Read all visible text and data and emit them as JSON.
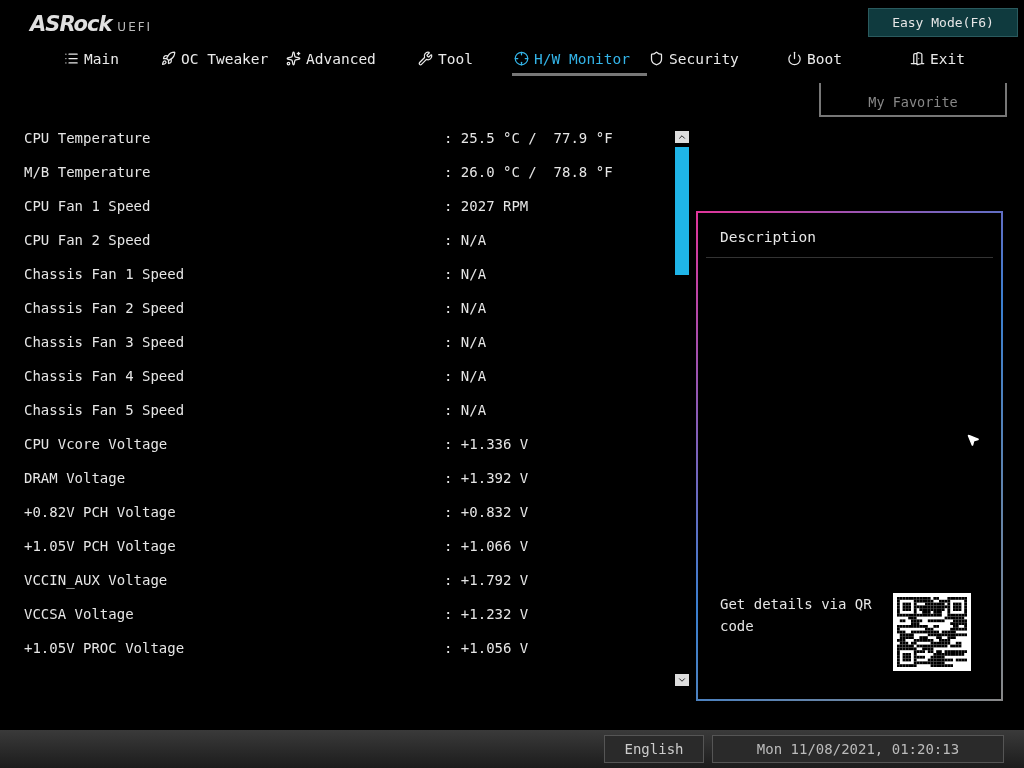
{
  "header": {
    "logo": "ASRock",
    "logo_suffix": "UEFI",
    "mode_button": "Easy Mode(F6)"
  },
  "tabs": [
    {
      "label": "Main",
      "kind": "list",
      "selected": false
    },
    {
      "label": "OC Tweaker",
      "kind": "rocket",
      "selected": false
    },
    {
      "label": "Advanced",
      "kind": "star",
      "selected": false
    },
    {
      "label": "Tool",
      "kind": "tools",
      "selected": false
    },
    {
      "label": "H/W Monitor",
      "kind": "monitor",
      "selected": true
    },
    {
      "label": "Security",
      "kind": "shield",
      "selected": false
    },
    {
      "label": "Boot",
      "kind": "power",
      "selected": false
    },
    {
      "label": "Exit",
      "kind": "exit",
      "selected": false
    }
  ],
  "favorite_button": "My Favorite",
  "readings": [
    {
      "label": "CPU Temperature",
      "value": ": 25.5 °C /  77.9 °F"
    },
    {
      "label": "M/B Temperature",
      "value": ": 26.0 °C /  78.8 °F"
    },
    {
      "label": "CPU Fan 1 Speed",
      "value": ": 2027 RPM"
    },
    {
      "label": "CPU Fan 2 Speed",
      "value": ": N/A"
    },
    {
      "label": "Chassis Fan 1 Speed",
      "value": ": N/A"
    },
    {
      "label": "Chassis Fan 2 Speed",
      "value": ": N/A"
    },
    {
      "label": "Chassis Fan 3 Speed",
      "value": ": N/A"
    },
    {
      "label": "Chassis Fan 4 Speed",
      "value": ": N/A"
    },
    {
      "label": "Chassis Fan 5 Speed",
      "value": ": N/A"
    },
    {
      "label": "CPU Vcore Voltage",
      "value": ": +1.336 V"
    },
    {
      "label": "DRAM Voltage",
      "value": ": +1.392 V"
    },
    {
      "label": "+0.82V PCH Voltage",
      "value": ": +0.832 V"
    },
    {
      "label": "+1.05V PCH Voltage",
      "value": ": +1.066 V"
    },
    {
      "label": "VCCIN_AUX Voltage",
      "value": ": +1.792 V"
    },
    {
      "label": "VCCSA Voltage",
      "value": ": +1.232 V"
    },
    {
      "label": "+1.05V PROC Voltage",
      "value": ": +1.056 V"
    }
  ],
  "description": {
    "title": "Description",
    "qr_text": "Get details via QR code"
  },
  "status_bar": {
    "language": "English",
    "datetime": "Mon 11/08/2021, 01:20:13"
  }
}
